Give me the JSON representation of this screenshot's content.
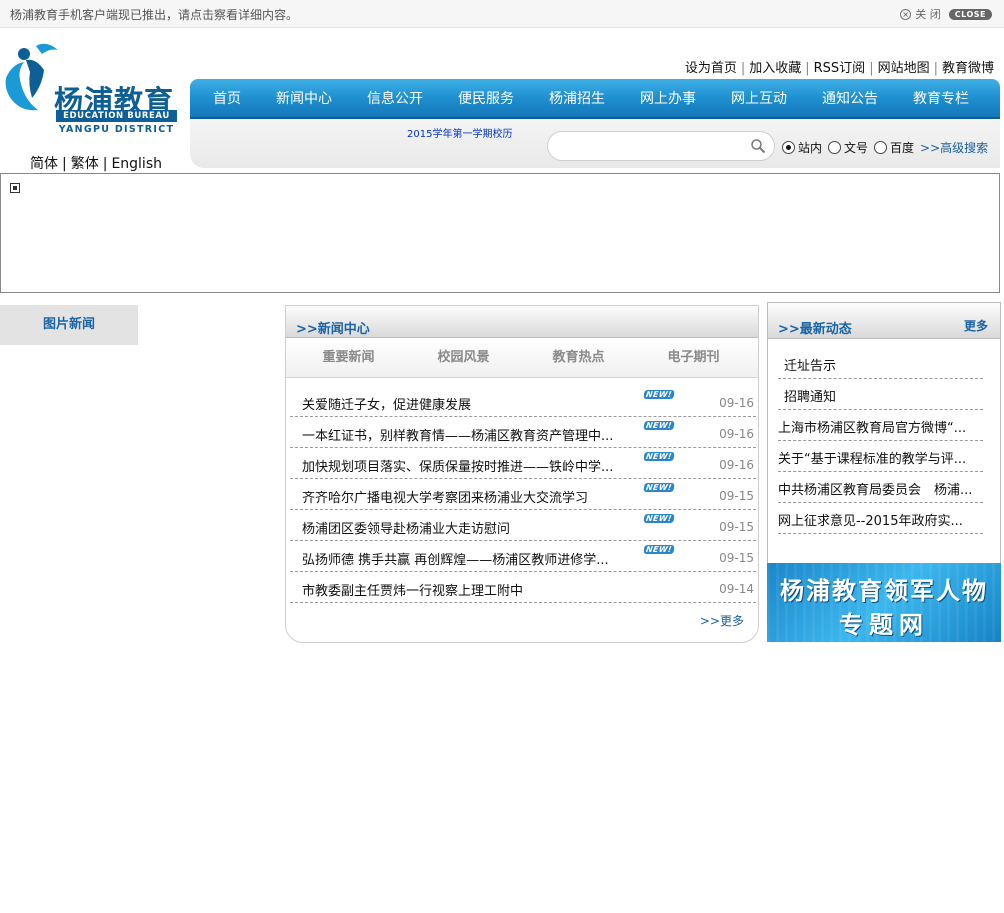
{
  "notice": {
    "text": "杨浦教育手机客户端现已推出，请点击察看详细内容。",
    "close_label": "关 闭",
    "close_badge": "CLOSE"
  },
  "logo": {
    "name_cn": "杨浦教育",
    "name_en_1": "EDUCATION BUREAU",
    "name_en_2": "YANGPU DISTRICT"
  },
  "language": {
    "simplified": "简体",
    "traditional": "繁体",
    "english": "English",
    "separator": "|"
  },
  "top_links": {
    "items": [
      "设为首页",
      "加入收藏",
      "RSS订阅",
      "网站地图",
      "教育微博"
    ],
    "separator": "|"
  },
  "nav": {
    "items": [
      "首页",
      "新闻中心",
      "信息公开",
      "便民服务",
      "杨浦招生",
      "网上办事",
      "网上互动",
      "通知公告",
      "教育专栏"
    ]
  },
  "search": {
    "semester_link": "2015学年第一学期校历",
    "value": "",
    "options": [
      "站内",
      "文号",
      "百度"
    ],
    "selected": "站内",
    "advanced": ">>高级搜索"
  },
  "photo_news": {
    "label": "图片新闻"
  },
  "news_center": {
    "title": ">>新闻中心",
    "tabs": [
      "重要新闻",
      "校园风景",
      "教育热点",
      "电子期刊"
    ],
    "badge": "NEW!",
    "items": [
      {
        "title": "关爱随迁子女，促进健康发展",
        "date": "09-16",
        "new": true
      },
      {
        "title": "一本红证书，别样教育情——杨浦区教育资产管理中...",
        "date": "09-16",
        "new": true
      },
      {
        "title": "加快规划项目落实、保质保量按时推进——铁岭中学...",
        "date": "09-16",
        "new": true
      },
      {
        "title": "齐齐哈尔广播电视大学考察团来杨浦业大交流学习",
        "date": "09-15",
        "new": true
      },
      {
        "title": "杨浦团区委领导赴杨浦业大走访慰问",
        "date": "09-15",
        "new": true
      },
      {
        "title": "弘扬师德 携手共赢 再创辉煌——杨浦区教师进修学...",
        "date": "09-15",
        "new": true
      },
      {
        "title": "市教委副主任贾炜一行视察上理工附中",
        "date": "09-14",
        "new": false
      }
    ],
    "more": ">>更多"
  },
  "latest": {
    "title": ">>最新动态",
    "more": "更多",
    "items": [
      "迁址告示",
      "招聘通知",
      "上海市杨浦区教育局官方微博“...",
      "关于“基于课程标准的教学与评...",
      "中共杨浦区教育局委员会　杨浦...",
      "网上征求意见--2015年政府实..."
    ]
  },
  "leader_banner": {
    "line1": "杨浦教育领军人物",
    "line2": "专题网"
  },
  "colors": {
    "nav_blue": "#1e8fd0",
    "brand_blue": "#0d5f95",
    "title_blue": "#1a64a5"
  }
}
